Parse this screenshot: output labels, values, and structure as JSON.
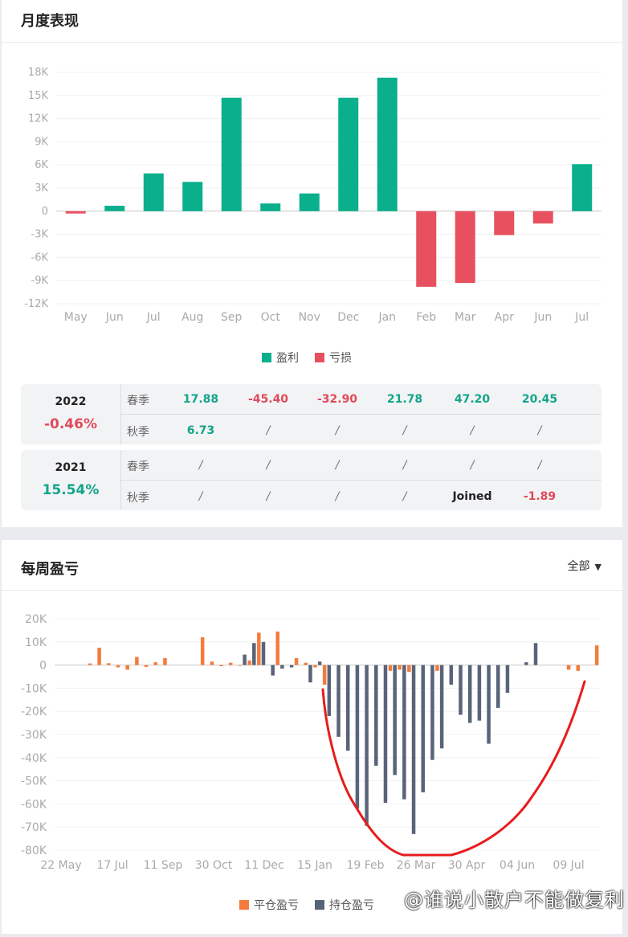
{
  "monthly": {
    "title": "月度表现",
    "legend": {
      "profit": "盈利",
      "loss": "亏损"
    },
    "colors": {
      "profit": "#0aaf8c",
      "loss": "#e8505f"
    }
  },
  "stats": [
    {
      "year": "2022",
      "return": "-0.46%",
      "return_sign": "neg",
      "rows": [
        {
          "season": "春季",
          "cells": [
            "17.88",
            "-45.40",
            "-32.90",
            "21.78",
            "47.20",
            "20.45"
          ]
        },
        {
          "season": "秋季",
          "cells": [
            "6.73",
            "/",
            "/",
            "/",
            "/",
            "/"
          ]
        }
      ]
    },
    {
      "year": "2021",
      "return": "15.54%",
      "return_sign": "pos",
      "rows": [
        {
          "season": "春季",
          "cells": [
            "/",
            "/",
            "/",
            "/",
            "/",
            "/"
          ]
        },
        {
          "season": "秋季",
          "cells": [
            "/",
            "/",
            "/",
            "/",
            "Joined",
            "-1.89"
          ]
        }
      ]
    }
  ],
  "weekly": {
    "title": "每周盈亏",
    "filter_label": "全部",
    "legend": {
      "closed": "平仓盈亏",
      "holding": "持仓盈亏"
    },
    "colors": {
      "closed": "#f47b3e",
      "holding": "#586479",
      "annotation": "#e81c1c"
    }
  },
  "watermark": "@谁说小散户不能做复利",
  "chart_data": [
    {
      "type": "bar",
      "title": "月度表现",
      "categories": [
        "May",
        "Jun",
        "Jul",
        "Aug",
        "Sep",
        "Oct",
        "Nov",
        "Dec",
        "Jan",
        "Feb",
        "Mar",
        "Apr",
        "Jun",
        "Jul"
      ],
      "values": [
        -300,
        700,
        4900,
        3800,
        14700,
        1000,
        2300,
        14700,
        17300,
        -9800,
        -9300,
        -3100,
        -1600,
        6100
      ],
      "ylim": [
        -12000,
        18000
      ],
      "yticks": [
        18000,
        15000,
        12000,
        9000,
        6000,
        3000,
        0,
        -3000,
        -6000,
        -9000,
        -12000
      ],
      "ytick_labels": [
        "18K",
        "15K",
        "12K",
        "9K",
        "6K",
        "3K",
        "0",
        "-3K",
        "-6K",
        "-9K",
        "-12K"
      ],
      "legend": [
        "盈利",
        "亏损"
      ],
      "legend_position": "bottom-center",
      "grid": true
    },
    {
      "type": "bar",
      "title": "每周盈亏",
      "x_tick_labels": [
        "22 May",
        "17 Jul",
        "11 Sep",
        "30 Oct",
        "11 Dec",
        "15 Jan",
        "19 Feb",
        "26 Mar",
        "30 Apr",
        "04 Jun",
        "09 Jul"
      ],
      "ylim": [
        -80000,
        20000
      ],
      "yticks": [
        20000,
        10000,
        0,
        -10000,
        -20000,
        -30000,
        -40000,
        -50000,
        -60000,
        -70000,
        -80000
      ],
      "ytick_labels": [
        "20K",
        "10K",
        "0",
        "-10K",
        "-20K",
        "-30K",
        "-40K",
        "-50K",
        "-60K",
        "-70K",
        "-80K"
      ],
      "series": [
        {
          "name": "平仓盈亏",
          "values": [
            0,
            0,
            0,
            700,
            7500,
            800,
            -1000,
            -2000,
            3500,
            -800,
            1200,
            3000,
            0,
            0,
            0,
            12000,
            1500,
            -500,
            1000,
            -300,
            2000,
            14000,
            0,
            14500,
            0,
            3000,
            1000,
            -1000,
            -8500,
            0,
            0,
            0,
            0,
            0,
            0,
            -2500,
            -2000,
            -3000,
            0,
            0,
            -2500,
            0,
            0,
            0,
            0,
            0,
            0,
            0,
            0,
            0,
            0,
            0,
            0,
            0,
            -2000,
            -2500,
            0,
            8500
          ]
        },
        {
          "name": "持仓盈亏",
          "values": [
            0,
            0,
            0,
            0,
            0,
            0,
            0,
            0,
            0,
            0,
            0,
            0,
            0,
            0,
            0,
            0,
            0,
            0,
            0,
            0,
            4500,
            9500,
            10000,
            -4500,
            -1500,
            -1000,
            0,
            -7500,
            1500,
            -22000,
            -31000,
            -37000,
            -62000,
            -69500,
            -43500,
            -59500,
            -47500,
            -58000,
            -73000,
            -55000,
            -41000,
            -36000,
            -8500,
            -21500,
            -25000,
            -24000,
            -34000,
            -18500,
            -12000,
            0,
            1200,
            9500,
            0,
            0,
            0,
            0,
            0,
            0
          ]
        }
      ],
      "legend": [
        "平仓盈亏",
        "持仓盈亏"
      ],
      "legend_position": "bottom-center",
      "grid": true
    }
  ]
}
